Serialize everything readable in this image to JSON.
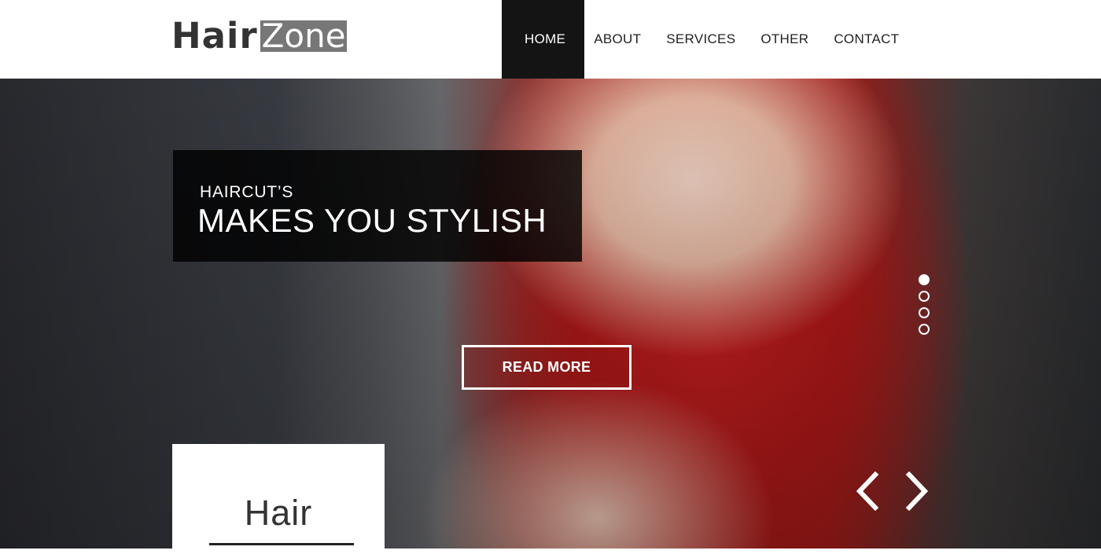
{
  "logo": {
    "part1": "Hair",
    "part2": "Zone"
  },
  "nav": [
    {
      "label": "HOME",
      "active": true
    },
    {
      "label": "ABOUT",
      "active": false
    },
    {
      "label": "SERVICES",
      "active": false
    },
    {
      "label": "OTHER",
      "active": false
    },
    {
      "label": "CONTACT",
      "active": false
    }
  ],
  "hero": {
    "subtitle": "HAIRCUT’S",
    "title": "MAKES YOU STYLISH",
    "button_label": "READ MORE",
    "slides_count": 4,
    "active_slide": 1
  },
  "feature": {
    "title": "Hair"
  },
  "colors": {
    "nav_active_bg": "#141414",
    "caption_bg": "#000000",
    "hair_accent": "#c81f1f"
  },
  "icons": {
    "prev": "chevron-left-icon",
    "next": "chevron-right-icon"
  }
}
